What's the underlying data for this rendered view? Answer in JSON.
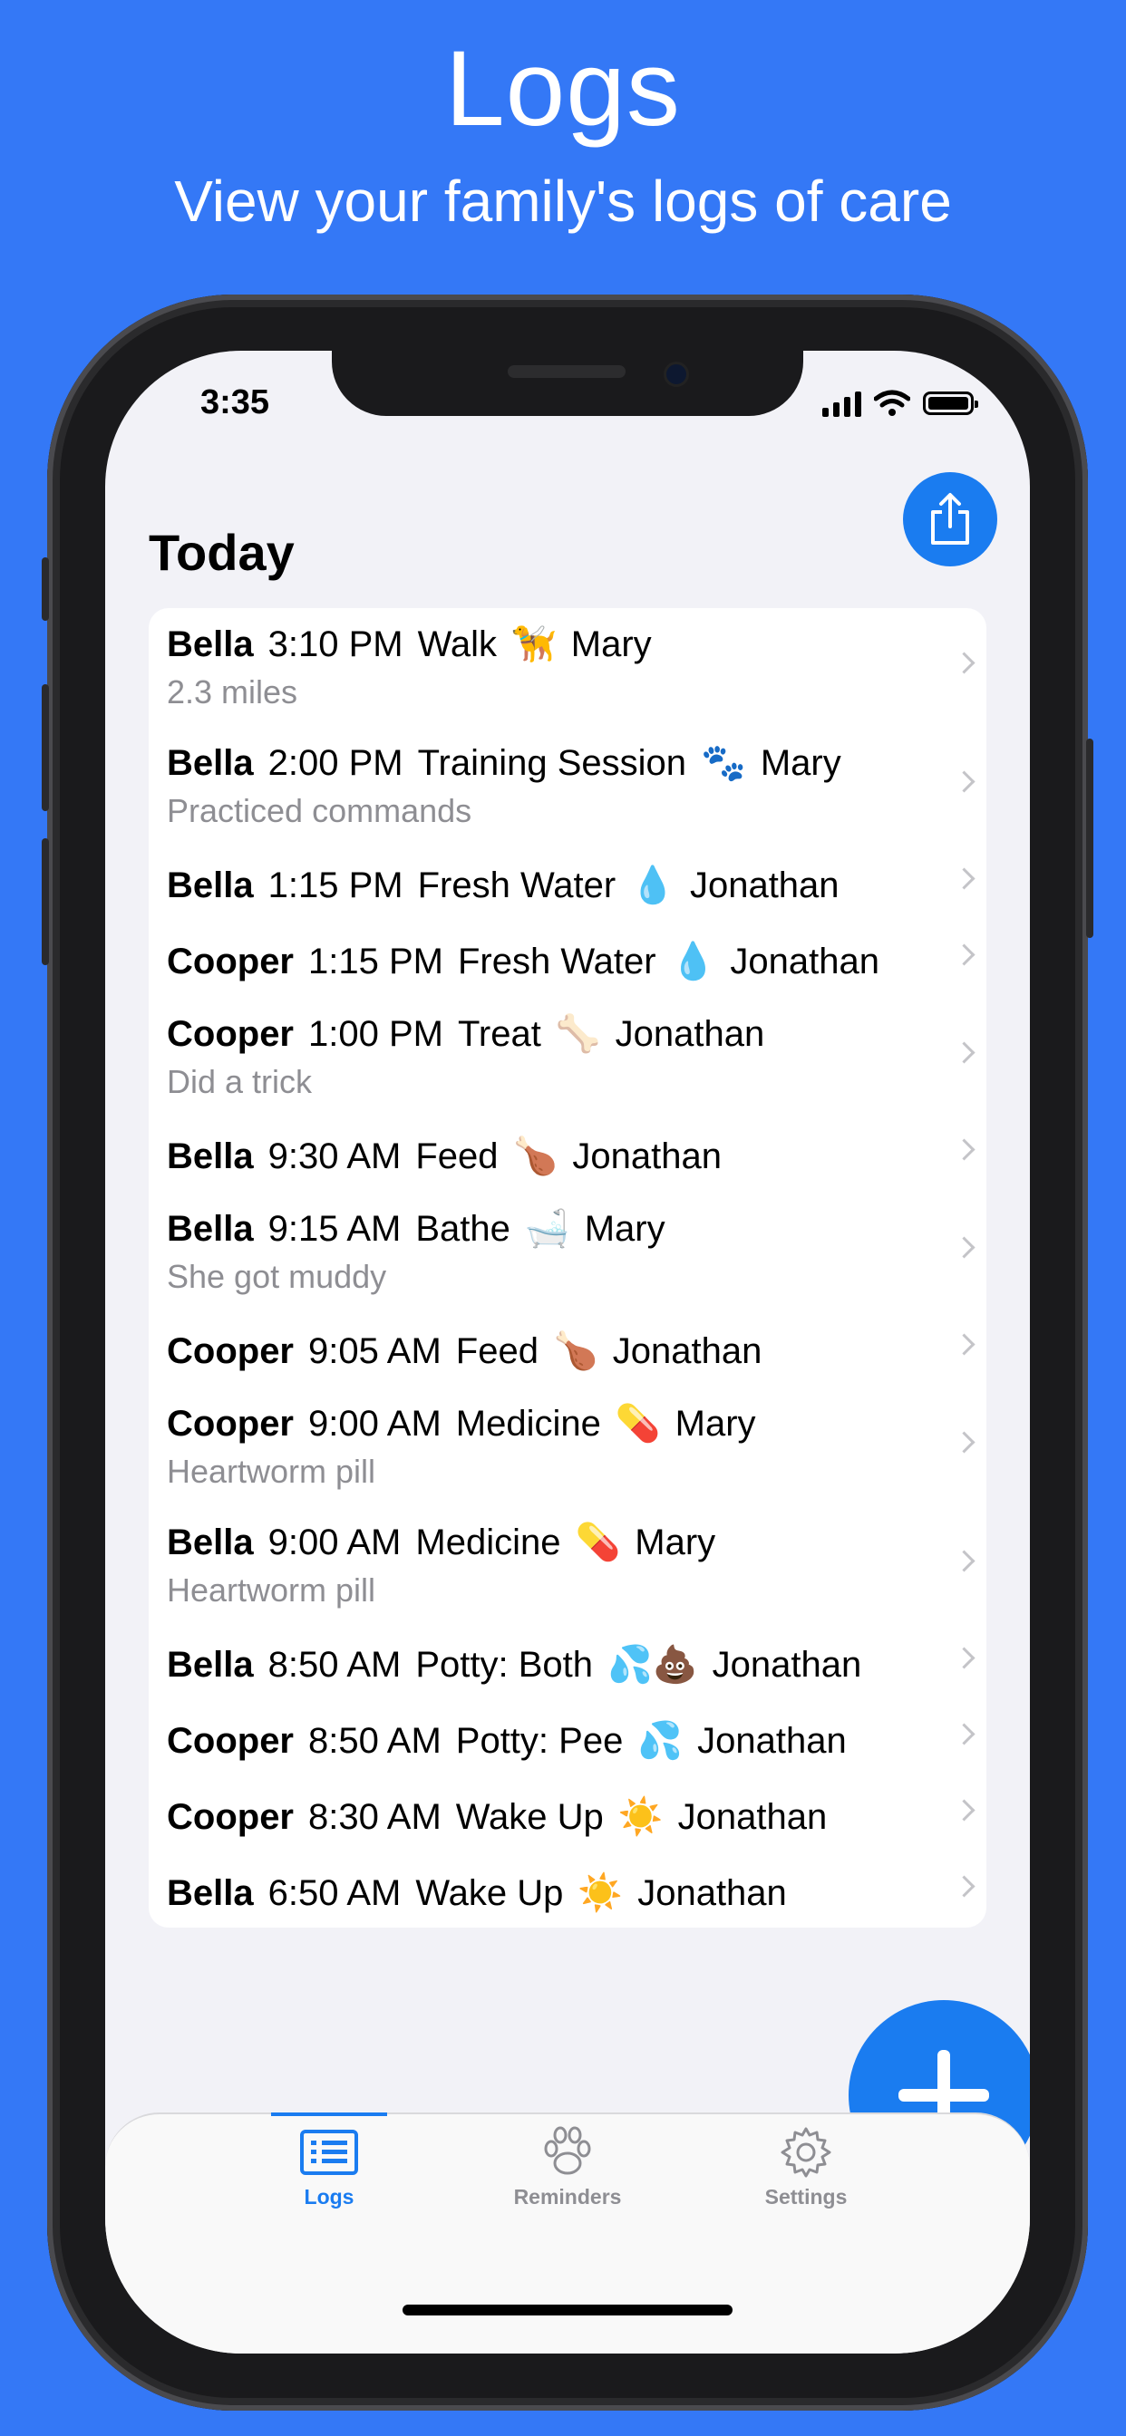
{
  "hero": {
    "title": "Logs",
    "subtitle": "View your family's logs of care"
  },
  "status": {
    "time": "3:35"
  },
  "section": {
    "title": "Today"
  },
  "logs": [
    {
      "pet": "Bella",
      "time": "3:10 PM",
      "activity": "Walk",
      "emoji": "🦮",
      "person": "Mary",
      "note": "2.3 miles"
    },
    {
      "pet": "Bella",
      "time": "2:00 PM",
      "activity": "Training Session",
      "emoji": "🐾",
      "person": "Mary",
      "note": "Practiced commands"
    },
    {
      "pet": "Bella",
      "time": "1:15 PM",
      "activity": "Fresh Water",
      "emoji": "💧",
      "person": "Jonathan",
      "note": ""
    },
    {
      "pet": "Cooper",
      "time": "1:15 PM",
      "activity": "Fresh Water",
      "emoji": "💧",
      "person": "Jonathan",
      "note": ""
    },
    {
      "pet": "Cooper",
      "time": "1:00 PM",
      "activity": "Treat",
      "emoji": "🦴",
      "person": "Jonathan",
      "note": "Did a trick"
    },
    {
      "pet": "Bella",
      "time": "9:30 AM",
      "activity": "Feed",
      "emoji": "🍗",
      "person": "Jonathan",
      "note": ""
    },
    {
      "pet": "Bella",
      "time": "9:15 AM",
      "activity": "Bathe",
      "emoji": "🛁",
      "person": "Mary",
      "note": "She got muddy"
    },
    {
      "pet": "Cooper",
      "time": "9:05 AM",
      "activity": "Feed",
      "emoji": "🍗",
      "person": "Jonathan",
      "note": ""
    },
    {
      "pet": "Cooper",
      "time": "9:00 AM",
      "activity": "Medicine",
      "emoji": "💊",
      "person": "Mary",
      "note": "Heartworm pill"
    },
    {
      "pet": "Bella",
      "time": "9:00 AM",
      "activity": "Medicine",
      "emoji": "💊",
      "person": "Mary",
      "note": "Heartworm pill"
    },
    {
      "pet": "Bella",
      "time": "8:50 AM",
      "activity": "Potty: Both",
      "emoji": "💦💩",
      "person": "Jonathan",
      "note": ""
    },
    {
      "pet": "Cooper",
      "time": "8:50 AM",
      "activity": "Potty: Pee",
      "emoji": "💦",
      "person": "Jonathan",
      "note": ""
    },
    {
      "pet": "Cooper",
      "time": "8:30 AM",
      "activity": "Wake Up",
      "emoji": "☀️",
      "person": "Jonathan",
      "note": ""
    },
    {
      "pet": "Bella",
      "time": "6:50 AM",
      "activity": "Wake Up",
      "emoji": "☀️",
      "person": "Jonathan",
      "note": ""
    }
  ],
  "tabs": [
    {
      "label": "Logs",
      "icon": "list-icon",
      "active": true
    },
    {
      "label": "Reminders",
      "icon": "paw-icon",
      "active": false
    },
    {
      "label": "Settings",
      "icon": "gear-icon",
      "active": false
    }
  ],
  "colors": {
    "background": "#3478f6",
    "accent": "#1a7cf0",
    "inactive": "#8e8e93"
  }
}
